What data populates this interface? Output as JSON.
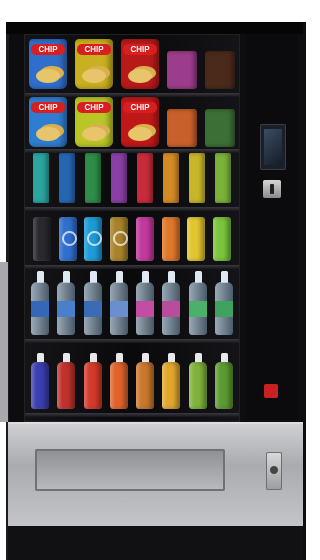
{
  "machine": {
    "brand_badge": "",
    "chip_brand": "CHIP"
  },
  "colors": {
    "frame": "#0d0d0f",
    "bay_metal": "#b7b8bb",
    "chip_red": "#d81e1e"
  },
  "icons": {
    "payment_screen": "payment-screen-icon",
    "coin_slot": "coin-slot-icon",
    "lock": "key-lock-icon"
  }
}
